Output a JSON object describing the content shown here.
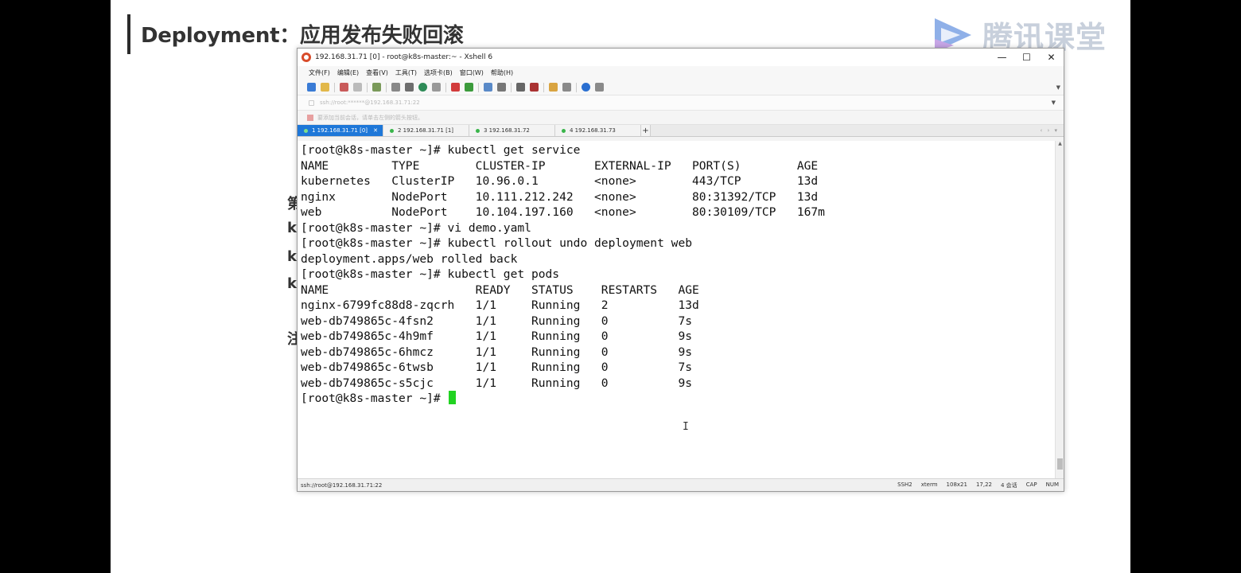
{
  "slide": {
    "title": "Deployment：应用发布失败回滚",
    "logo_text": "腾讯课堂",
    "bg_glyphs": [
      "第",
      "ku",
      "k",
      "k",
      "注"
    ]
  },
  "window": {
    "title": "192.168.31.71 [0] - root@k8s-master:~ - Xshell 6",
    "controls": {
      "minimize": "—",
      "maximize": "☐",
      "close": "✕"
    }
  },
  "menu": [
    "文件(F)",
    "编辑(E)",
    "查看(V)",
    "工具(T)",
    "选项卡(B)",
    "窗口(W)",
    "帮助(H)"
  ],
  "address": {
    "text": "ssh://root:******@192.168.31.71:22"
  },
  "info": {
    "text": "要添加当前会话，请单击左侧的箭头按钮。"
  },
  "tabs": [
    {
      "label": "1 192.168.31.71 [0]",
      "active": true
    },
    {
      "label": "2 192.168.31.71 [1]",
      "active": false
    },
    {
      "label": "3 192.168.31.72",
      "active": false
    },
    {
      "label": "4 192.168.31.73",
      "active": false
    }
  ],
  "terminal": {
    "lines": [
      "[root@k8s-master ~]# kubectl get service",
      "NAME         TYPE        CLUSTER-IP       EXTERNAL-IP   PORT(S)        AGE",
      "kubernetes   ClusterIP   10.96.0.1        <none>        443/TCP        13d",
      "nginx        NodePort    10.111.212.242   <none>        80:31392/TCP   13d",
      "web          NodePort    10.104.197.160   <none>        80:30109/TCP   167m",
      "[root@k8s-master ~]# vi demo.yaml",
      "[root@k8s-master ~]# kubectl rollout undo deployment web",
      "deployment.apps/web rolled back",
      "[root@k8s-master ~]# kubectl get pods",
      "NAME                     READY   STATUS    RESTARTS   AGE",
      "nginx-6799fc88d8-zqcrh   1/1     Running   2          13d",
      "web-db749865c-4fsn2      1/1     Running   0          7s",
      "web-db749865c-4h9mf      1/1     Running   0          9s",
      "web-db749865c-6hmcz      1/1     Running   0          9s",
      "web-db749865c-6twsb      1/1     Running   0          7s",
      "web-db749865c-s5cjc      1/1     Running   0          9s"
    ],
    "prompt": "[root@k8s-master ~]# "
  },
  "statusbar": {
    "connection": "ssh://root@192.168.31.71:22",
    "protocol": "SSH2",
    "term": "xterm",
    "size": "108x21",
    "position": "17,22",
    "sessions": "4 会话",
    "caps": "CAP",
    "num": "NUM"
  }
}
